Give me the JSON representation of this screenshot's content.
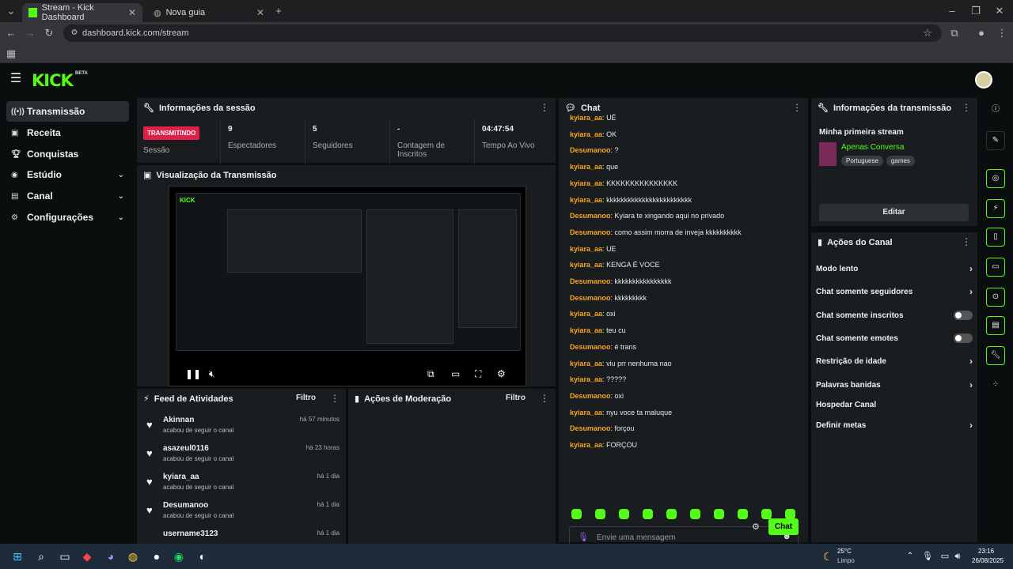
{
  "browser": {
    "tabs": [
      {
        "title": "Stream - Kick Dashboard"
      },
      {
        "title": "Nova guia"
      }
    ],
    "url": "dashboard.kick.com/stream"
  },
  "header": {
    "logo": "KICK",
    "logo_badge": "BETA"
  },
  "sidebar": {
    "items": [
      {
        "label": "Transmissão",
        "icon": "broadcast-icon"
      },
      {
        "label": "Receita",
        "icon": "revenue-icon"
      },
      {
        "label": "Conquistas",
        "icon": "trophy-icon"
      },
      {
        "label": "Estúdio",
        "icon": "studio-icon"
      },
      {
        "label": "Canal",
        "icon": "channel-icon"
      },
      {
        "label": "Configurações",
        "icon": "gear-icon"
      }
    ]
  },
  "session": {
    "title": "Informações da sessão",
    "live_badge": "TRANSMITINDO",
    "stats": [
      {
        "value": "",
        "label": "Sessão"
      },
      {
        "value": "9",
        "label": "Espectadores"
      },
      {
        "value": "5",
        "label": "Seguidores"
      },
      {
        "value": "-",
        "label": "Contagem de Inscritos"
      },
      {
        "value": "04:47:54",
        "label": "Tempo Ao Vivo"
      }
    ]
  },
  "preview": {
    "title": "Visualização da Transmissão"
  },
  "feed": {
    "title": "Feed de Atividades",
    "filter": "Filtro",
    "items": [
      {
        "name": "Akinnan",
        "desc": "acabou de seguir o canal",
        "time": "há 57 minutos"
      },
      {
        "name": "asazeul0116",
        "desc": "acabou de seguir o canal",
        "time": "há 23 horas"
      },
      {
        "name": "kyiara_aa",
        "desc": "acabou de seguir o canal",
        "time": "há 1 dia"
      },
      {
        "name": "Desumanoo",
        "desc": "acabou de seguir o canal",
        "time": "há 1 dia"
      },
      {
        "name": "username3123",
        "desc": "",
        "time": "há 1 dia"
      }
    ]
  },
  "moderation": {
    "title": "Ações de Moderação",
    "filter": "Filtro"
  },
  "chat": {
    "title": "Chat",
    "messages": [
      {
        "user": "kyiara_aa",
        "text": "UÉ",
        "color": "#f5a623"
      },
      {
        "user": "kyiara_aa",
        "text": "OK",
        "color": "#f5a623"
      },
      {
        "user": "Desumanoo",
        "text": "?",
        "color": "#f5a623"
      },
      {
        "user": "kyiara_aa",
        "text": "que",
        "color": "#f5a623"
      },
      {
        "user": "kyiara_aa",
        "text": "KKKKKKKKKKKKKKK",
        "color": "#f5a623"
      },
      {
        "user": "kyiara_aa",
        "text": "kkkkkkkkkkkkkkkkkkkkkkkk",
        "color": "#f5a623"
      },
      {
        "user": "Desumanoo",
        "text": "Kyiara te xingando aqui no privado",
        "color": "#f5a623"
      },
      {
        "user": "Desumanoo",
        "text": "como assim morra de inveja kkkkkkkkkk",
        "color": "#f5a623"
      },
      {
        "user": "kyiara_aa",
        "text": "UE",
        "color": "#f5a623"
      },
      {
        "user": "kyiara_aa",
        "text": "KENGA É VOCE",
        "color": "#f5a623"
      },
      {
        "user": "Desumanoo",
        "text": "kkkkkkkkkkkkkkkk",
        "color": "#f5a623"
      },
      {
        "user": "Desumanoo",
        "text": "kkkkkkkkk",
        "color": "#f5a623"
      },
      {
        "user": "kyiara_aa",
        "text": "oxi",
        "color": "#f5a623"
      },
      {
        "user": "kyiara_aa",
        "text": "teu cu",
        "color": "#f5a623"
      },
      {
        "user": "Desumanoo",
        "text": "é trans",
        "color": "#f5a623"
      },
      {
        "user": "kyiara_aa",
        "text": "viu prr nenhuma nao",
        "color": "#f5a623"
      },
      {
        "user": "kyiara_aa",
        "text": "?????",
        "color": "#f5a623"
      },
      {
        "user": "Desumanoo",
        "text": "oxi",
        "color": "#f5a623"
      },
      {
        "user": "kyiara_aa",
        "text": "nyu voce ta maluque",
        "color": "#f5a623"
      },
      {
        "user": "Desumanoo",
        "text": "forçou",
        "color": "#f5a623"
      },
      {
        "user": "kyiara_aa",
        "text": "FORÇOU",
        "color": "#f5a623"
      }
    ],
    "input_placeholder": "Envie uma mensagem",
    "send_label": "Chat"
  },
  "stream_info": {
    "title": "Informações da transmissão",
    "stream_title": "Minha primeira stream",
    "category": "Apenas Conversa",
    "tags": [
      "Portuguese",
      "games"
    ],
    "edit_label": "Editar"
  },
  "channel_actions": {
    "title": "Ações do Canal",
    "rows": [
      {
        "label": "Modo lento",
        "control": "chevron"
      },
      {
        "label": "Chat somente seguidores",
        "control": "chevron"
      },
      {
        "label": "Chat somente inscritos",
        "control": "toggle"
      },
      {
        "label": "Chat somente emotes",
        "control": "toggle"
      },
      {
        "label": "Restrição de idade",
        "control": "chevron"
      },
      {
        "label": "Palavras banidas",
        "control": "chevron"
      },
      {
        "label": "Hospedar Canal",
        "control": "none"
      },
      {
        "label": "Definir metas",
        "control": "chevron"
      }
    ]
  },
  "taskbar": {
    "weather_temp": "25°C",
    "weather_desc": "Limpo",
    "time": "23:16",
    "date": "26/08/2025"
  },
  "colors": {
    "accent": "#53fc18",
    "live": "#e0204a",
    "username": "#f5a623"
  }
}
